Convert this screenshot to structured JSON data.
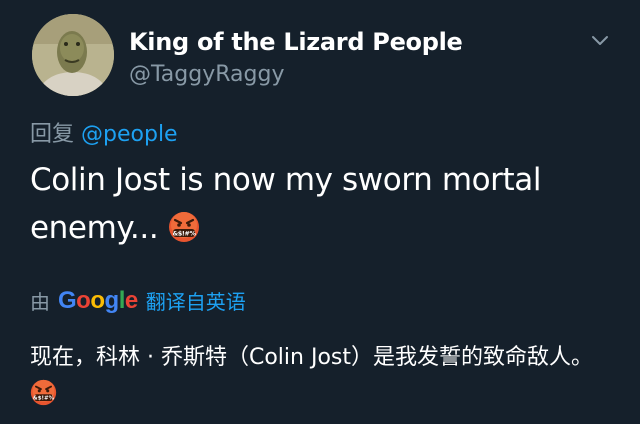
{
  "tweet": {
    "author": {
      "display_name": "King of the Lizard People",
      "handle": "@TaggyRaggy",
      "avatar_icon": "lizard-avatar-icon"
    },
    "reply": {
      "prefix": "回复",
      "mention": "@people"
    },
    "text": "Colin Jost is now my sworn mortal enemy...",
    "emoji": "face-with-symbols-on-mouth-icon",
    "translation": {
      "by_label": "由",
      "service": "Google",
      "link_label": "翻译自英语",
      "text": "现在，科林 · 乔斯特（Colin Jost）是我发誓的致命敌人。"
    }
  },
  "colors": {
    "background": "#15202b",
    "secondary_text": "#8899a6",
    "link": "#1da1f2",
    "primary_text": "#ffffff"
  }
}
